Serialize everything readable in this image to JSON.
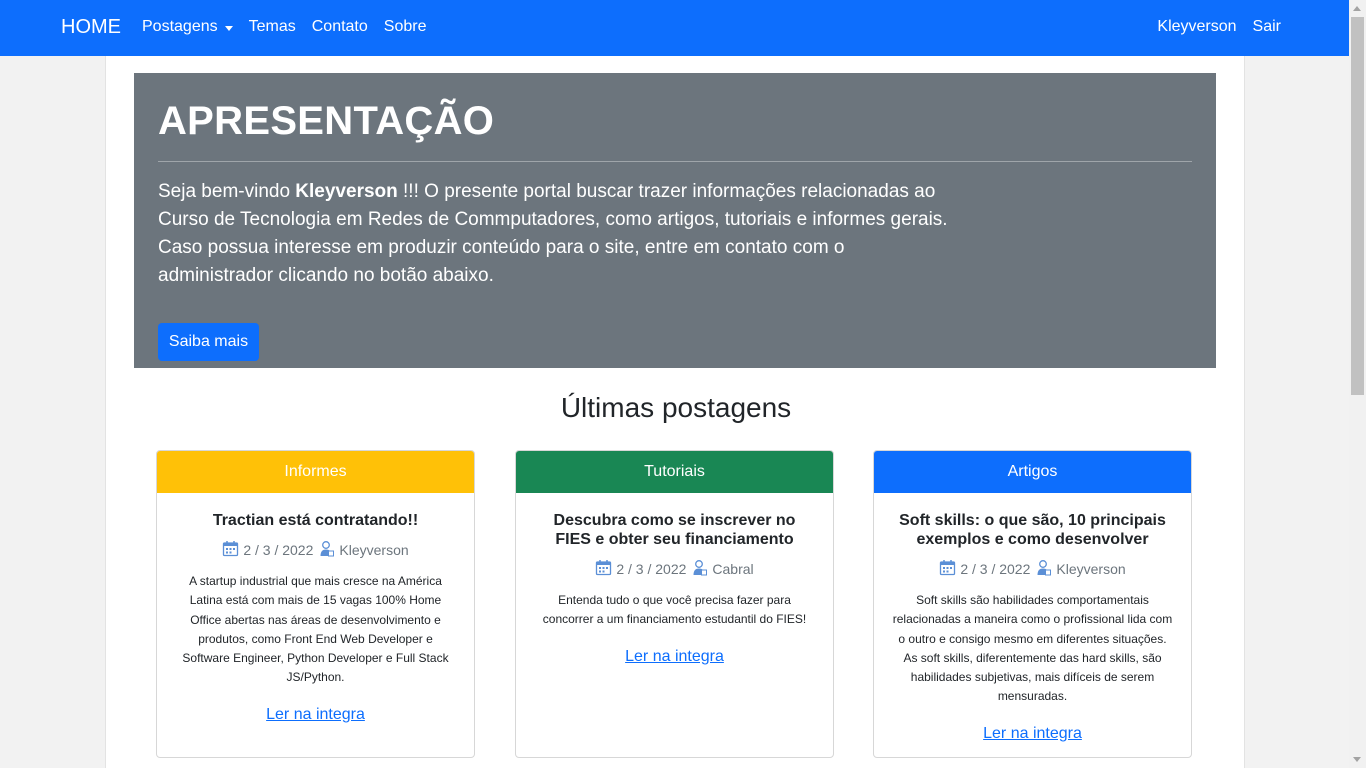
{
  "nav": {
    "brand": "HOME",
    "links": [
      "Postagens",
      "Temas",
      "Contato",
      "Sobre"
    ],
    "user": "Kleyverson",
    "logout": "Sair"
  },
  "jumbotron": {
    "title": "APRESENTAÇÃO",
    "text_pre": "Seja bem-vindo ",
    "user": "Kleyverson",
    "text_post": " !!! O presente portal buscar trazer informações relacionadas ao Curso de Tecnologia em Redes de Commputadores, como artigos, tutoriais e informes gerais. Caso possua interesse em produzir conteúdo para o site, entre em contato com o administrador clicando no botão abaixo.",
    "button": "Saiba mais"
  },
  "section_title": "Últimas postagens",
  "cards": [
    {
      "header": "Informes",
      "header_color": "#ffc107",
      "title": "Tractian está contratando!!",
      "date": "2 / 3 / 2022",
      "author": "Kleyverson",
      "text": "A startup industrial que mais cresce na América Latina está com mais de 15 vagas 100% Home Office abertas nas áreas de desenvolvimento e produtos, como Front End Web Developer e Software Engineer, Python Developer e Full Stack JS/Python.",
      "link": "Ler na integra"
    },
    {
      "header": "Tutoriais",
      "header_color": "#198754",
      "title": "Descubra como se inscrever no FIES e obter seu financiamento",
      "date": "2 / 3 / 2022",
      "author": "Cabral",
      "text": "Entenda tudo o que você precisa fazer para concorrer a um financiamento estudantil do FIES!",
      "link": "Ler na integra"
    },
    {
      "header": "Artigos",
      "header_color": "#0d6efd",
      "title": "Soft skills: o que são, 10 principais exemplos e como desenvolver",
      "date": "2 / 3 / 2022",
      "author": "Kleyverson",
      "text": "Soft skills são habilidades comportamentais relacionadas a maneira como o profissional lida com o outro e consigo mesmo em diferentes situações. As soft skills, diferentemente das hard skills, são habilidades subjetivas, mais difíceis de serem mensuradas.",
      "link": "Ler na integra"
    }
  ],
  "icons": {
    "date": "calendar-icon",
    "author": "user-icon"
  },
  "colors": {
    "primary": "#0d6efd",
    "secondary": "#6c757d"
  }
}
